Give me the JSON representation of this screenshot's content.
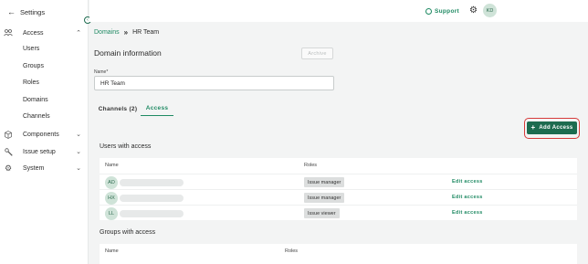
{
  "sidebar": {
    "header_title": "Settings",
    "sections": [
      {
        "label": "Access",
        "icon": "people-icon",
        "expanded": true
      },
      {
        "label": "Components",
        "icon": "cube-icon",
        "expanded": false
      },
      {
        "label": "Issue setup",
        "icon": "wrench-icon",
        "expanded": false
      },
      {
        "label": "System",
        "icon": "gear-icon",
        "expanded": false
      }
    ],
    "access_items": [
      "Users",
      "Groups",
      "Roles",
      "Domains",
      "Channels"
    ]
  },
  "topbar": {
    "support_label": "Support",
    "avatar_initials": "KD"
  },
  "breadcrumb": {
    "parent": "Domains",
    "current": "HR Team"
  },
  "domain_info": {
    "title": "Domain information",
    "archive_label": "Archive",
    "name_label": "Name*",
    "name_value": "HR Team"
  },
  "tabs": [
    {
      "label": "Channels (2)",
      "active": false
    },
    {
      "label": "Access",
      "active": true
    }
  ],
  "add_access_label": "Add Access",
  "users_section": {
    "title": "Users with access",
    "columns": [
      "Name",
      "Roles"
    ],
    "rows": [
      {
        "initials": "AD",
        "role": "Issue manager",
        "action": "Edit access"
      },
      {
        "initials": "HX",
        "role": "Issue manager",
        "action": "Edit access"
      },
      {
        "initials": "LL",
        "role": "Issue viewer",
        "action": "Edit access"
      }
    ]
  },
  "groups_section": {
    "title": "Groups with access",
    "columns": [
      "Name",
      "Roles"
    ]
  },
  "colors": {
    "accent": "#1f8a63",
    "primary_button": "#1d6b4f",
    "highlight": "#d63a3a"
  }
}
